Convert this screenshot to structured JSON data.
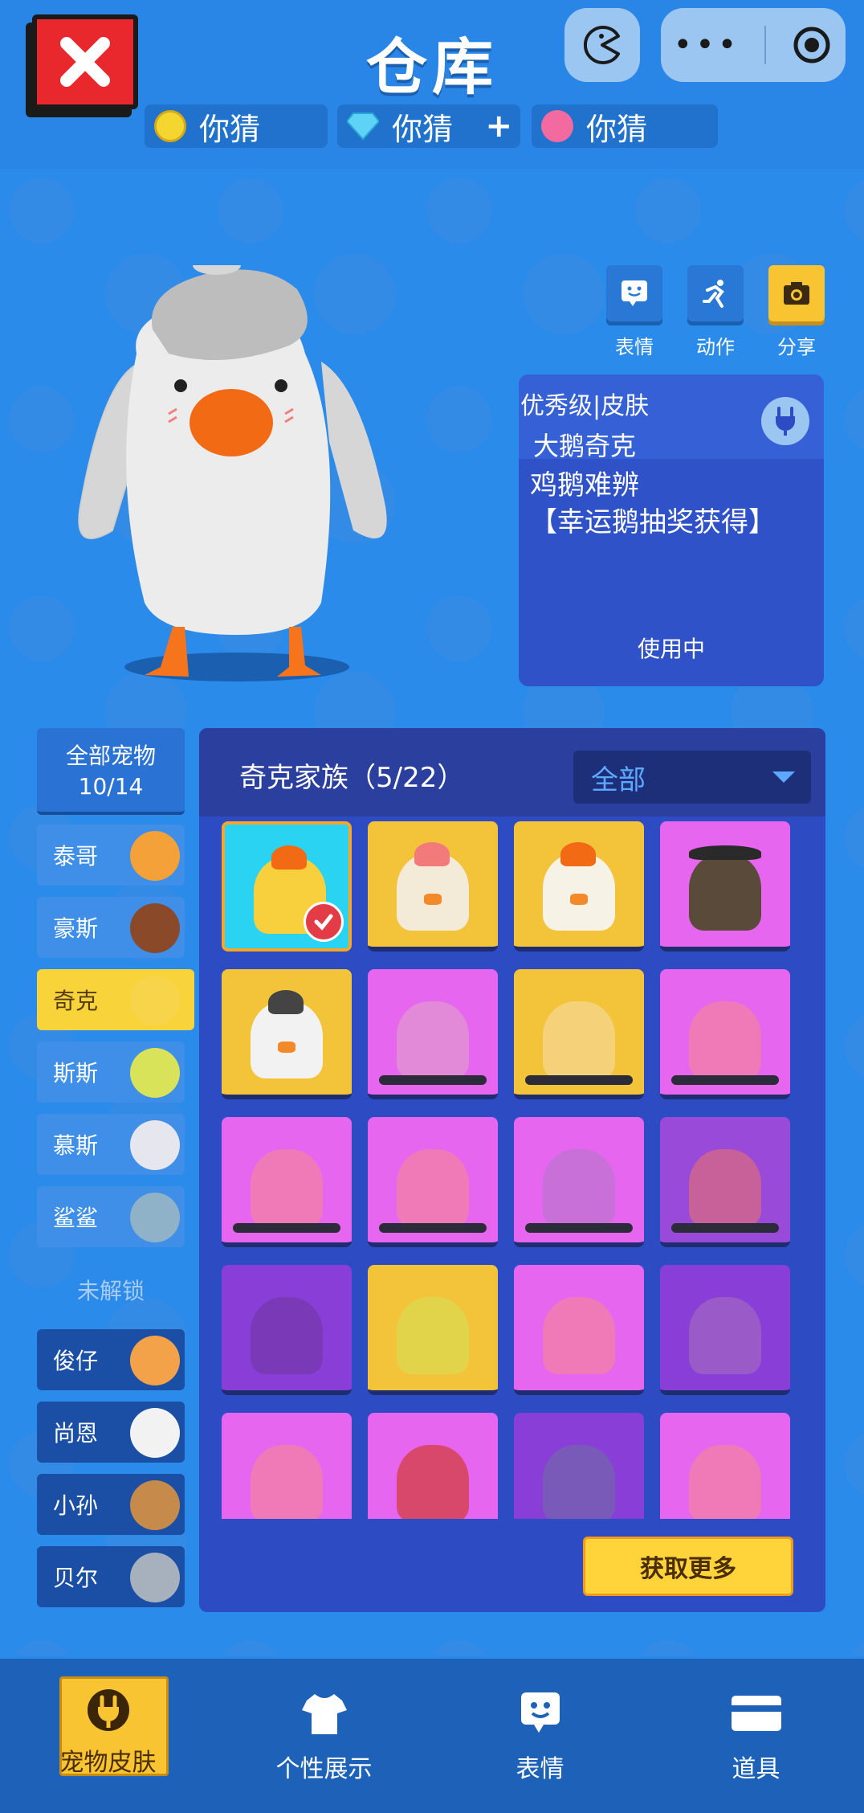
{
  "header": {
    "title": "仓库",
    "currencies": [
      {
        "icon": "coin-icon",
        "value": "你猜",
        "has_plus": false
      },
      {
        "icon": "diamond-icon",
        "value": "你猜",
        "has_plus": true
      },
      {
        "icon": "flower-icon",
        "value": "你猜",
        "has_plus": false
      }
    ]
  },
  "actions": [
    {
      "label": "表情",
      "icon": "emoji-icon"
    },
    {
      "label": "动作",
      "icon": "run-icon"
    },
    {
      "label": "分享",
      "icon": "camera-icon"
    }
  ],
  "skin": {
    "rank": "优秀级|皮肤",
    "name": "大鹅奇克",
    "description_line1": "鸡鹅难辨",
    "description_line2": "【幸运鹅抽奖获得】",
    "status": "使用中"
  },
  "categories": {
    "all_label": "全部宠物",
    "all_count": "10/14",
    "unlocked": [
      "泰哥",
      "豪斯",
      "奇克",
      "斯斯",
      "慕斯",
      "鲨鲨"
    ],
    "active": "奇克",
    "locked_title": "未解锁",
    "locked": [
      "俊仔",
      "尚恩",
      "小孙",
      "贝尔"
    ]
  },
  "panel": {
    "family_title": "奇克家族（5/22）",
    "filter_value": "全部",
    "get_more_label": "获取更多"
  },
  "nav": [
    {
      "label": "宠物皮肤",
      "icon": "plug-icon",
      "active": true
    },
    {
      "label": "个性展示",
      "icon": "shirt-icon",
      "active": false
    },
    {
      "label": "表情",
      "icon": "emoji-icon",
      "active": false
    },
    {
      "label": "道具",
      "icon": "card-icon",
      "active": false
    }
  ],
  "colors": {
    "background": "#2b8bea",
    "accent_yellow": "#f8c431",
    "panel": "#2d4cc4",
    "close_red": "#e8282c"
  }
}
